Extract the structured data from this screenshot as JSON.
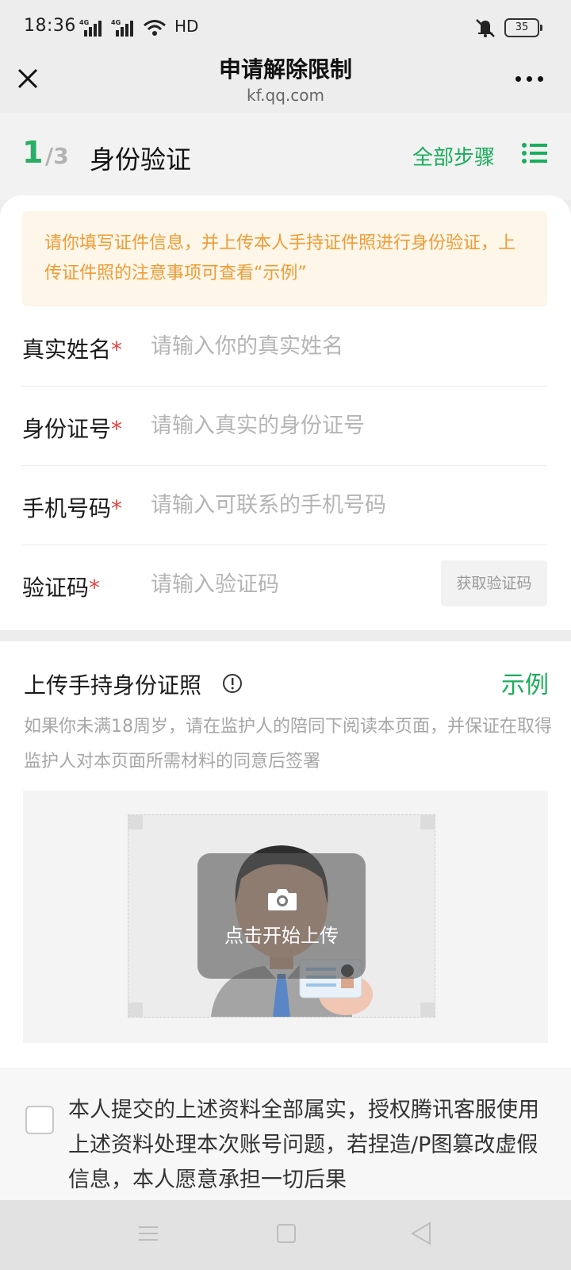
{
  "status_bar": {
    "time": "18:36",
    "network_1": "4G",
    "network_2": "4G",
    "hd_label": "HD",
    "battery": "35",
    "icons": [
      "signal-icon",
      "wifi-icon",
      "mute-bell-icon",
      "battery-icon"
    ]
  },
  "nav": {
    "title": "申请解除限制",
    "subtitle": "kf.qq.com",
    "close_icon": "close-icon",
    "more_icon": "more-dots-icon"
  },
  "step": {
    "current": "1",
    "total": "/3",
    "title": "身份验证",
    "all_steps_label": "全部步骤",
    "list_icon": "list-icon"
  },
  "notice": {
    "text": "请你填写证件信息，并上传本人手持证件照进行身份验证，上传证件照的注意事项可查看“示例”"
  },
  "form": {
    "required_mark": "*",
    "fields": [
      {
        "label": "真实姓名",
        "placeholder": "请输入你的真实姓名",
        "value": ""
      },
      {
        "label": "身份证号",
        "placeholder": "请输入真实的身份证号",
        "value": ""
      },
      {
        "label": "手机号码",
        "placeholder": "请输入可联系的手机号码",
        "value": ""
      },
      {
        "label": "验证码",
        "placeholder": "请输入验证码",
        "value": ""
      }
    ],
    "get_code_label": "获取验证码"
  },
  "upload": {
    "title": "上传手持身份证照",
    "example_label": "示例",
    "description": "如果你未满18周岁，请在监护人的陪同下阅读本页面，并保证在取得监护人对本页面所需材料的同意后签署",
    "button_label": "点击开始上传",
    "camera_icon": "camera-icon",
    "info_icon": "info-icon"
  },
  "agreement": {
    "checked": false,
    "text": "本人提交的上述资料全部属实，授权腾讯客服使用上述资料处理本次账号问题，若捏造/P图篡改虚假信息，本人愿意承担一切后果"
  },
  "bottom_nav": {
    "icons": [
      "menu-icon",
      "home-icon",
      "back-icon"
    ]
  },
  "colors": {
    "accent_green": "#1aad5b",
    "notice_text": "#ef9c34",
    "notice_bg": "#fdf6e9",
    "required_red": "#e64340"
  }
}
